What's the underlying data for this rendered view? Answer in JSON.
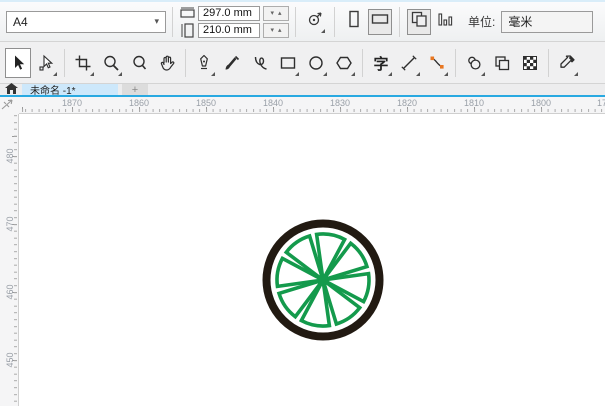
{
  "property_bar": {
    "page_size_value": "A4",
    "page_width_value": "297.0 mm",
    "page_height_value": "210.0 mm",
    "spin_down": "▾",
    "spin_up": "▴",
    "combo_arrow": "▾",
    "units_label": "单位:",
    "units_value": "毫米",
    "icons": [
      "page-width-icon",
      "page-height-icon",
      "nudge-offset-icon",
      "portrait-icon",
      "landscape-icon",
      "all-pages-icon",
      "current-page-icon"
    ]
  },
  "toolbox": {
    "text_tool_label": "字",
    "tools": [
      {
        "name": "pick-tool",
        "selected": true
      },
      {
        "name": "shape-tool",
        "flyout": true
      },
      {
        "name": "crop-tool",
        "flyout": true
      },
      {
        "name": "zoom-tool",
        "flyout": true
      },
      {
        "name": "zoom-out-tool"
      },
      {
        "name": "pan-tool"
      },
      {
        "name": "pen-tool",
        "flyout": true
      },
      {
        "name": "brush-tool"
      },
      {
        "name": "bspline-tool"
      },
      {
        "name": "rectangle-tool",
        "flyout": true
      },
      {
        "name": "ellipse-tool",
        "flyout": true
      },
      {
        "name": "polygon-tool",
        "flyout": true
      },
      {
        "name": "text-tool",
        "flyout": true
      },
      {
        "name": "dimension-tool",
        "flyout": true
      },
      {
        "name": "connector-tool",
        "flyout": true
      },
      {
        "name": "shadow-tool",
        "flyout": true
      },
      {
        "name": "contour-tool"
      },
      {
        "name": "pattern-fill-tool"
      },
      {
        "name": "eyedropper-tool",
        "flyout": true
      }
    ]
  },
  "tab_bar": {
    "active_tab": "未命名 -1*",
    "new_tab_label": "+"
  },
  "rulers": {
    "unit": "mm",
    "horizontal_labels": [
      "1870",
      "1860",
      "1850",
      "1840",
      "1830",
      "1820",
      "1810",
      "1800",
      "17"
    ],
    "vertical_labels": [
      "480",
      "470",
      "460",
      "450"
    ]
  },
  "canvas": {
    "object": "wheel-logo",
    "logo": {
      "ring_color": "#221a12",
      "segment_color": "#149a4c",
      "segment_count": 8,
      "fill": "#ffffff"
    }
  },
  "colors": {
    "accent_blue": "#29a9e1",
    "tab_active_bg": "#cde8fb",
    "toolbar_bg": "#f0f0f1",
    "connector_handle_orange": "#e87722"
  }
}
